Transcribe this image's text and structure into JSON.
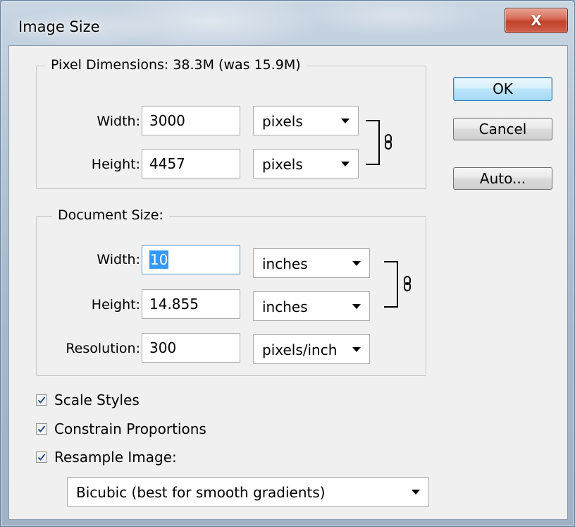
{
  "window": {
    "title": "Image Size",
    "close_label": "X"
  },
  "pixel_dimensions": {
    "legend": "Pixel Dimensions:  38.3M (was 15.9M)",
    "width_label": "Width:",
    "width_value": "3000",
    "width_unit": "pixels",
    "height_label": "Height:",
    "height_value": "4457",
    "height_unit": "pixels"
  },
  "document_size": {
    "legend": "Document Size:",
    "width_label": "Width:",
    "width_value": "10",
    "width_unit": "inches",
    "height_label": "Height:",
    "height_value": "14.855",
    "height_unit": "inches",
    "resolution_label": "Resolution:",
    "resolution_value": "300",
    "resolution_unit": "pixels/inch"
  },
  "buttons": {
    "ok": "OK",
    "cancel": "Cancel",
    "auto": "Auto..."
  },
  "options": {
    "scale_styles": {
      "label": "Scale Styles",
      "checked": true
    },
    "constrain_proportions": {
      "label": "Constrain Proportions",
      "checked": true
    },
    "resample_image": {
      "label": "Resample Image:",
      "checked": true
    },
    "resample_method": "Bicubic (best for smooth gradients)"
  }
}
